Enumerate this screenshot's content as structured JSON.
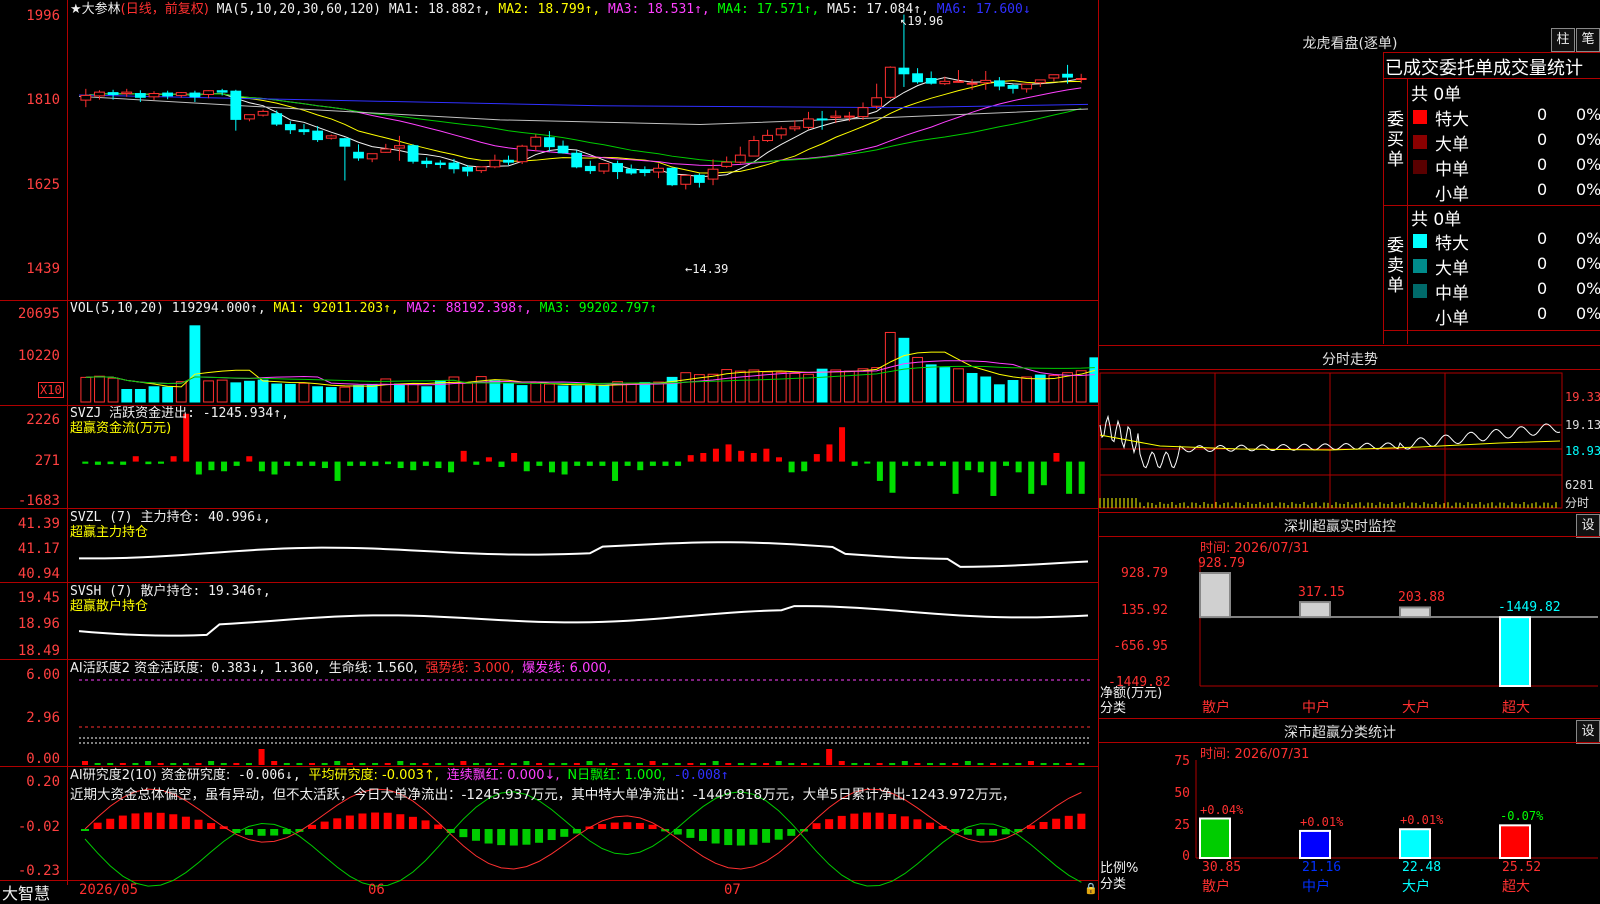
{
  "main": {
    "title": "★大参林",
    "subtitle": "(日线，前复权)",
    "ma_label": "MA(5,10,20,30,60,120)",
    "ma1": "MA1: 18.882↑,",
    "ma2": "MA2: 18.799↑,",
    "ma3": "MA3: 18.531↑,",
    "ma4": "MA4: 17.571↑,",
    "ma5": "MA5: 17.084↑,",
    "ma6": "MA6: 17.600↓",
    "y_labels": [
      "1996",
      "1810",
      "1625",
      "1439"
    ],
    "high_marker": "19.96",
    "low_marker": "←14.39",
    "candles": [
      [
        18.14,
        18.38,
        18.24,
        17.99
      ],
      [
        18.23,
        18.35,
        18.31,
        18.15
      ],
      [
        18.3,
        18.36,
        18.26,
        18.15
      ],
      [
        18.28,
        18.38,
        18.31,
        18.21
      ],
      [
        18.28,
        18.35,
        18.2,
        18.1
      ],
      [
        18.21,
        18.33,
        18.28,
        18.14
      ],
      [
        18.29,
        18.34,
        18.23,
        18.16
      ],
      [
        18.24,
        18.31,
        18.3,
        18.19
      ],
      [
        18.29,
        18.34,
        18.21,
        18.1
      ],
      [
        18.26,
        18.35,
        18.34,
        18.18
      ],
      [
        18.34,
        18.38,
        18.31,
        18.24
      ],
      [
        18.33,
        18.36,
        17.73,
        17.49
      ],
      [
        17.74,
        17.8,
        17.83,
        17.69
      ],
      [
        17.82,
        17.94,
        17.9,
        17.79
      ],
      [
        17.85,
        17.92,
        17.63,
        17.59
      ],
      [
        17.62,
        17.69,
        17.51,
        17.42
      ],
      [
        17.51,
        17.63,
        17.47,
        17.4
      ],
      [
        17.48,
        17.59,
        17.3,
        17.25
      ],
      [
        17.33,
        17.41,
        17.38,
        17.3
      ],
      [
        17.32,
        17.34,
        17.16,
        16.43
      ],
      [
        17.03,
        17.2,
        16.91,
        16.85
      ],
      [
        16.89,
        16.93,
        17.0,
        16.82
      ],
      [
        17.03,
        17.21,
        17.1,
        17.02
      ],
      [
        17.12,
        17.38,
        17.17,
        16.85
      ],
      [
        17.17,
        17.2,
        16.84,
        16.79
      ],
      [
        16.84,
        16.92,
        16.79,
        16.7
      ],
      [
        16.8,
        16.86,
        16.77,
        16.69
      ],
      [
        16.8,
        16.89,
        16.68,
        16.58
      ],
      [
        16.71,
        16.76,
        16.63,
        16.52
      ],
      [
        16.64,
        16.7,
        16.72,
        16.59
      ],
      [
        16.72,
        16.98,
        16.86,
        16.69
      ],
      [
        16.86,
        16.96,
        16.82,
        16.76
      ],
      [
        16.83,
        17.19,
        17.16,
        16.78
      ],
      [
        17.16,
        17.41,
        17.35,
        17.05
      ],
      [
        17.34,
        17.48,
        17.15,
        17.05
      ],
      [
        17.16,
        17.28,
        17.02,
        17.0
      ],
      [
        17.01,
        17.07,
        16.72,
        16.69
      ],
      [
        16.73,
        16.85,
        16.64,
        16.57
      ],
      [
        16.63,
        16.71,
        16.79,
        16.57
      ],
      [
        16.79,
        16.85,
        16.62,
        16.46
      ],
      [
        16.67,
        16.77,
        16.59,
        16.55
      ],
      [
        16.66,
        16.73,
        16.6,
        16.52
      ],
      [
        16.61,
        16.79,
        16.69,
        16.48
      ],
      [
        16.69,
        16.7,
        16.34,
        16.31
      ],
      [
        16.35,
        16.4,
        16.54,
        16.24
      ],
      [
        16.54,
        16.58,
        16.39,
        16.28
      ],
      [
        16.46,
        16.88,
        16.67,
        16.33
      ],
      [
        16.73,
        16.94,
        16.82,
        16.7
      ],
      [
        16.82,
        17.15,
        16.97,
        16.79
      ],
      [
        16.95,
        17.38,
        17.28,
        16.95
      ],
      [
        17.28,
        17.51,
        17.39,
        17.25
      ],
      [
        17.4,
        17.58,
        17.53,
        17.31
      ],
      [
        17.53,
        17.71,
        17.57,
        17.48
      ],
      [
        17.56,
        17.89,
        17.74,
        17.52
      ],
      [
        17.74,
        17.91,
        17.73,
        17.51
      ],
      [
        17.77,
        17.92,
        17.8,
        17.65
      ],
      [
        17.8,
        17.89,
        17.8,
        17.69
      ],
      [
        17.79,
        18.09,
        17.98,
        17.72
      ],
      [
        18.01,
        18.49,
        18.19,
        17.95
      ],
      [
        18.2,
        18.86,
        18.84,
        18.17
      ],
      [
        18.82,
        19.96,
        18.7,
        18.42
      ],
      [
        18.7,
        18.82,
        18.53,
        18.49
      ],
      [
        18.6,
        18.75,
        18.5,
        18.47
      ],
      [
        18.49,
        18.64,
        18.54,
        18.46
      ],
      [
        18.54,
        18.78,
        18.54,
        18.51
      ],
      [
        18.48,
        18.59,
        18.5,
        18.36
      ],
      [
        18.51,
        18.76,
        18.56,
        18.36
      ],
      [
        18.55,
        18.63,
        18.44,
        18.35
      ],
      [
        18.45,
        18.48,
        18.39,
        18.28
      ],
      [
        18.38,
        18.48,
        18.48,
        18.3
      ],
      [
        18.51,
        18.57,
        18.57,
        18.42
      ],
      [
        18.61,
        18.68,
        18.68,
        18.54
      ],
      [
        18.69,
        18.89,
        18.63,
        18.49
      ],
      [
        18.6,
        18.7,
        18.6,
        18.5
      ]
    ]
  },
  "vol": {
    "label": "VOL(5,10,20)",
    "value": "119294.000↑,",
    "ma1": "MA1: 92011.203↑,",
    "ma2": "MA2: 88192.398↑,",
    "ma3": "MA3: 99202.797↑",
    "y_labels": [
      "20695",
      "10220"
    ],
    "unit": "X10",
    "values": [
      6300,
      6600,
      6100,
      3200,
      3200,
      3900,
      3800,
      5200,
      19500,
      5400,
      5600,
      4900,
      5300,
      5600,
      4600,
      4500,
      4800,
      3900,
      3700,
      3800,
      4200,
      4500,
      5900,
      4600,
      4700,
      3900,
      5500,
      6400,
      4800,
      6500,
      5400,
      4700,
      4200,
      5000,
      4600,
      4100,
      4100,
      4200,
      4300,
      5200,
      4600,
      5000,
      5100,
      6300,
      7500,
      7000,
      7100,
      8300,
      7900,
      8200,
      7700,
      7600,
      7300,
      7100,
      8400,
      8200,
      7900,
      8500,
      8800,
      17800,
      16300,
      11400,
      9500,
      8800,
      8500,
      7300,
      6400,
      4400,
      5500,
      6400,
      6900,
      6800,
      7500,
      8000,
      11300
    ],
    "red_flags": [
      1,
      1,
      1,
      0,
      0,
      0,
      0,
      1,
      0,
      1,
      1,
      0,
      0,
      0,
      0,
      0,
      1,
      0,
      0,
      1,
      0,
      0,
      1,
      0,
      1,
      0,
      0,
      1,
      1,
      1,
      0,
      0,
      0,
      1,
      1,
      0,
      0,
      0,
      0,
      1,
      1,
      0,
      1,
      0,
      1,
      1,
      1,
      1,
      1,
      1,
      1,
      1,
      1,
      1,
      0,
      1,
      1,
      1,
      1,
      1,
      0,
      1,
      0,
      0,
      1,
      0,
      0,
      0,
      0,
      1,
      0,
      1,
      1,
      1,
      0
    ]
  },
  "svzj": {
    "label": "SVZJ  活跃资金进出:",
    "value": "-1245.934↑,",
    "sub": "超赢资金流(万元)",
    "y_labels": [
      "2226",
      "271",
      "-1683"
    ],
    "values": [
      -100,
      -150,
      -120,
      -150,
      250,
      -120,
      -100,
      250,
      2226,
      -600,
      -400,
      -450,
      -200,
      250,
      -450,
      -600,
      -200,
      -200,
      -200,
      -300,
      -900,
      -200,
      -200,
      -200,
      -120,
      -300,
      -400,
      -200,
      -300,
      -500,
      500,
      -150,
      200,
      -250,
      400,
      -450,
      -200,
      -500,
      -600,
      -200,
      -200,
      -200,
      -900,
      -200,
      -400,
      -200,
      -200,
      -200,
      300,
      400,
      600,
      800,
      500,
      400,
      600,
      200,
      -500,
      -450,
      350,
      800,
      1600,
      -200,
      -50,
      -900,
      -1450,
      -200,
      -200,
      -200,
      -200,
      -1500,
      -400,
      -500,
      -1600,
      -200,
      -500,
      -1500,
      -1100,
      400,
      -1500,
      -1500
    ]
  },
  "svzl": {
    "label": "SVZL (7) 主力持仓:",
    "value": "40.996↓,",
    "sub": "超赢主力持仓",
    "y_labels": [
      "41.39",
      "41.17",
      "40.94"
    ]
  },
  "svsh": {
    "label": "SVSH (7) 散户持仓:",
    "value": "19.346↑,",
    "sub": "超赢散户持仓",
    "y_labels": [
      "19.45",
      "18.96",
      "18.49"
    ]
  },
  "ai_active": {
    "label": "AI活跃度2 资金活跃度:",
    "v1": "0.383↓,",
    "v2": "1.360,",
    "v3": "生命线: 1.560,",
    "v4": "强势线: 3.000,",
    "v5": "爆发线: 6.000,",
    "y_labels": [
      "6.00",
      "2.96",
      "0.00"
    ]
  },
  "ai_research": {
    "label": "AI研究度2(10) 资金研究度:",
    "v1": "-0.006↓,",
    "v2": "平均研究度: -0.003↑,",
    "v3": "连续飘红: 0.000↓,",
    "v4": "N日飘红: 1.000,",
    "v5": "-0.008↑",
    "comment": "近期大资金总体偏空，虽有异动，但不太活跃，今日大单净流出：-1245.937万元，其中特大单净流出：-1449.818万元，大单5日累计净出-1243.972万元，",
    "y_labels": [
      "0.20",
      "-0.02",
      "-0.23"
    ]
  },
  "bottom": {
    "brand": "大智慧",
    "date1": "2026/05",
    "date2": "06",
    "date3": "07"
  },
  "lhk": {
    "title": "龙虎看盘(逐单)",
    "btn1": "柱",
    "btn2": "笔",
    "header": "已成交委托单成交量统计",
    "buy_label": "委买单",
    "sell_label": "委卖单",
    "buy_total": "共 0单",
    "sell_total": "共 0单",
    "buy_rows": [
      {
        "name": "特大",
        "val": "0",
        "pct": "0%",
        "color": "#ff0000"
      },
      {
        "name": "大单",
        "val": "0",
        "pct": "0%",
        "color": "#8b0000"
      },
      {
        "name": "中单",
        "val": "0",
        "pct": "0%",
        "color": "#5a0000"
      },
      {
        "name": "小单",
        "val": "0",
        "pct": "0%",
        "color": ""
      }
    ],
    "sell_rows": [
      {
        "name": "特大",
        "val": "0",
        "pct": "0%",
        "color": "#00ffff"
      },
      {
        "name": "大单",
        "val": "0",
        "pct": "0%",
        "color": "#008b8b"
      },
      {
        "name": "中单",
        "val": "0",
        "pct": "0%",
        "color": "#006a6a"
      },
      {
        "name": "小单",
        "val": "0",
        "pct": "0%",
        "color": ""
      }
    ]
  },
  "intraday": {
    "title": "分时走势",
    "y_labels": [
      "19.33",
      "19.13",
      "18.93"
    ],
    "vol_label": "6281",
    "min_label": "分时"
  },
  "monitor": {
    "title": "深圳超赢实时监控",
    "btn": "设",
    "time": "时间: 2026/07/31",
    "y_labels": [
      "928.79",
      "135.92",
      "-656.95",
      "-1449.82"
    ],
    "y_unit": "净额(万元)",
    "x_unit": "分类",
    "categories": [
      "散户",
      "中户",
      "大户",
      "超大"
    ],
    "value_labels": [
      "928.79",
      "317.15",
      "203.88",
      "-1449.82"
    ],
    "values": [
      928.79,
      317.15,
      203.88,
      -1449.82
    ]
  },
  "classify": {
    "title": "深市超赢分类统计",
    "btn": "设",
    "time": "时间: 2026/07/31",
    "y_labels": [
      "75",
      "50",
      "25",
      "0"
    ],
    "y_unit": "比例%",
    "x_unit": "分类",
    "categories": [
      "散户",
      "中户",
      "大户",
      "超大"
    ],
    "pct_labels": [
      "+0.04%",
      "+0.01%",
      "+0.01%",
      "-0.07%"
    ],
    "values": [
      30.85,
      21.16,
      22.48,
      25.52
    ],
    "value_labels": [
      "30.85",
      "21.16",
      "22.48",
      "25.52"
    ]
  }
}
